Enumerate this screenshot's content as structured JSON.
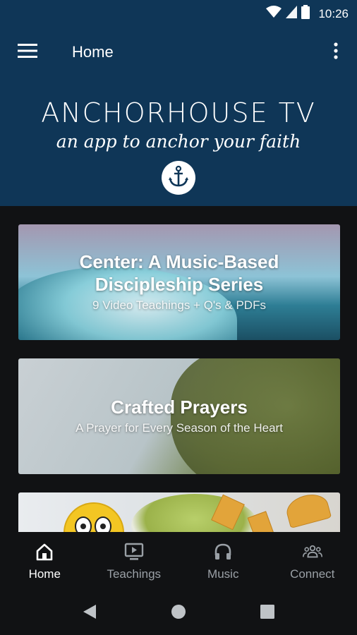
{
  "status_bar": {
    "time": "10:26",
    "icons": [
      "wifi-icon",
      "signal-icon",
      "battery-icon"
    ]
  },
  "app_bar": {
    "title": "Home",
    "menu_icon": "hamburger-menu-icon",
    "overflow_icon": "more-vertical-icon"
  },
  "banner": {
    "title": "ANCHORHOUSE TV",
    "tagline": "an app to anchor your faith",
    "logo_icon": "anchor-icon"
  },
  "cards": [
    {
      "title": "Center: A Music-Based Discipleship Series",
      "subtitle": "9 Video Teachings + Q's & PDFs"
    },
    {
      "title": "Crafted Prayers",
      "subtitle": "A Prayer for Every Season of the Heart"
    },
    {
      "title": "",
      "subtitle": ""
    }
  ],
  "bottom_nav": {
    "items": [
      {
        "label": "Home",
        "icon": "home-icon",
        "active": true
      },
      {
        "label": "Teachings",
        "icon": "tv-icon",
        "active": false
      },
      {
        "label": "Music",
        "icon": "headphones-icon",
        "active": false
      },
      {
        "label": "Connect",
        "icon": "group-icon",
        "active": false
      }
    ]
  },
  "system_nav": {
    "icons": [
      "back-icon",
      "home-circle-icon",
      "recents-icon"
    ]
  },
  "colors": {
    "header_bg": "#0f3657",
    "page_bg": "#111214",
    "nav_inactive": "#9aa0a6"
  }
}
